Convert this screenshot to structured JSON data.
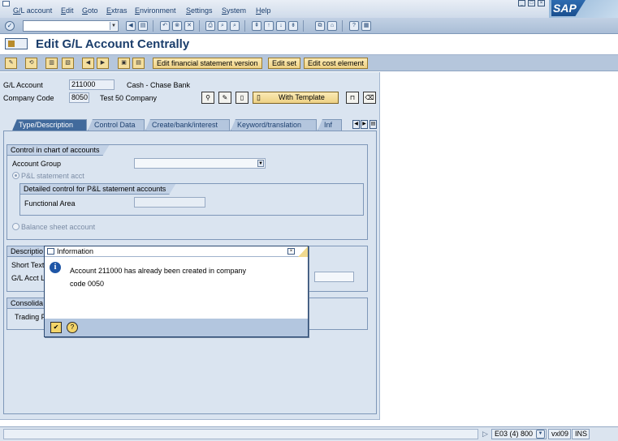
{
  "menubar": {
    "items": [
      "G/L account",
      "Edit",
      "Goto",
      "Extras",
      "Environment",
      "Settings",
      "System",
      "Help"
    ],
    "logo": "SAP"
  },
  "title": "Edit G/L Account Centrally",
  "app_toolbar": {
    "buttons": [
      "Edit financial statement version",
      "Edit set",
      "Edit cost element"
    ]
  },
  "header": {
    "gl_account_label": "G/L Account",
    "gl_account_value": "211000",
    "gl_account_desc": "Cash - Chase Bank",
    "company_code_label": "Company Code",
    "company_code_value": "8050",
    "company_name": "Test 50 Company",
    "with_template_label": "With Template"
  },
  "tabs": [
    "Type/Description",
    "Control Data",
    "Create/bank/interest",
    "Keyword/translation",
    "Inf"
  ],
  "control_group": {
    "title": "Control in chart of accounts",
    "account_group_label": "Account Group",
    "pl_radio_label": "P&L statement acct",
    "detail_title": "Detailed control for P&L statement accounts",
    "functional_area_label": "Functional Area",
    "balance_radio_label": "Balance sheet account"
  },
  "description_group": {
    "title": "Descriptio",
    "short_text_label": "Short Text",
    "long_label": "G/L Acct L"
  },
  "consolidation_group": {
    "title": "Consolida",
    "trading_label": "Trading P"
  },
  "dialog": {
    "title": "Information",
    "message_line1": "Account 211000 has already been created in company",
    "message_line2": "code 0050"
  },
  "status": {
    "system": "E03 (4) 800",
    "server": "vxl09",
    "mode": "INS"
  }
}
